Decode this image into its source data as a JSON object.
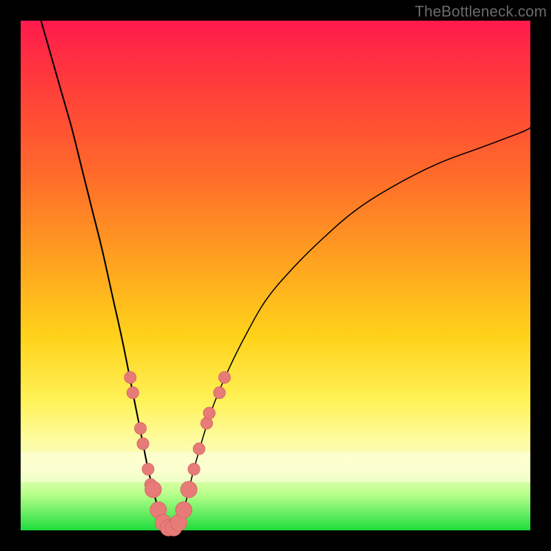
{
  "watermark": "TheBottleneck.com",
  "chart_data": {
    "type": "line",
    "title": "",
    "xlabel": "",
    "ylabel": "",
    "xlim": [
      0,
      100
    ],
    "ylim": [
      0,
      100
    ],
    "grid": false,
    "legend": false,
    "background": {
      "kind": "vertical_gradient",
      "stops": [
        {
          "pos": 0,
          "color": "#ff1a4d"
        },
        {
          "pos": 12,
          "color": "#ff3b3b"
        },
        {
          "pos": 30,
          "color": "#ff6a2a"
        },
        {
          "pos": 48,
          "color": "#ffa51f"
        },
        {
          "pos": 62,
          "color": "#ffd21a"
        },
        {
          "pos": 75,
          "color": "#fff35a"
        },
        {
          "pos": 83,
          "color": "#fdfca7"
        },
        {
          "pos": 88,
          "color": "#f8ffbf"
        },
        {
          "pos": 93,
          "color": "#b6ff8a"
        },
        {
          "pos": 100,
          "color": "#1fdd3d"
        }
      ]
    },
    "series": [
      {
        "name": "left_branch",
        "x": [
          4,
          6,
          8,
          10,
          12,
          14,
          16,
          18,
          20,
          22,
          23,
          24,
          25,
          26,
          27,
          28
        ],
        "y": [
          100,
          93,
          86,
          79,
          71,
          63,
          55,
          46,
          37,
          27,
          22,
          17,
          12,
          8,
          4,
          1
        ]
      },
      {
        "name": "right_branch",
        "x": [
          31,
          32,
          33,
          34,
          36,
          38,
          41,
          44,
          48,
          53,
          59,
          66,
          74,
          82,
          90,
          98,
          100
        ],
        "y": [
          1,
          4,
          8,
          12,
          19,
          25,
          32,
          38,
          45,
          51,
          57,
          63,
          68,
          72,
          75,
          78,
          79
        ]
      },
      {
        "name": "valley_floor",
        "x": [
          28,
          29,
          30,
          31
        ],
        "y": [
          1,
          0,
          0,
          1
        ]
      }
    ],
    "markers": [
      {
        "x": 21.5,
        "y": 30,
        "r": 1.3
      },
      {
        "x": 22,
        "y": 27,
        "r": 1.3
      },
      {
        "x": 23.5,
        "y": 20,
        "r": 1.3
      },
      {
        "x": 24,
        "y": 17,
        "r": 1.3
      },
      {
        "x": 25,
        "y": 12,
        "r": 1.3
      },
      {
        "x": 25.5,
        "y": 9,
        "r": 1.3
      },
      {
        "x": 26,
        "y": 8,
        "r": 1.8
      },
      {
        "x": 27,
        "y": 4,
        "r": 1.8
      },
      {
        "x": 28,
        "y": 1.5,
        "r": 1.8
      },
      {
        "x": 29,
        "y": 0.5,
        "r": 1.8
      },
      {
        "x": 30,
        "y": 0.5,
        "r": 1.8
      },
      {
        "x": 31,
        "y": 1.5,
        "r": 1.8
      },
      {
        "x": 32,
        "y": 4,
        "r": 1.8
      },
      {
        "x": 33,
        "y": 8,
        "r": 1.8
      },
      {
        "x": 34,
        "y": 12,
        "r": 1.3
      },
      {
        "x": 35,
        "y": 16,
        "r": 1.3
      },
      {
        "x": 36.5,
        "y": 21,
        "r": 1.3
      },
      {
        "x": 37,
        "y": 23,
        "r": 1.3
      },
      {
        "x": 39,
        "y": 27,
        "r": 1.3
      },
      {
        "x": 40,
        "y": 30,
        "r": 1.3
      }
    ],
    "watermark": "TheBottleneck.com"
  }
}
